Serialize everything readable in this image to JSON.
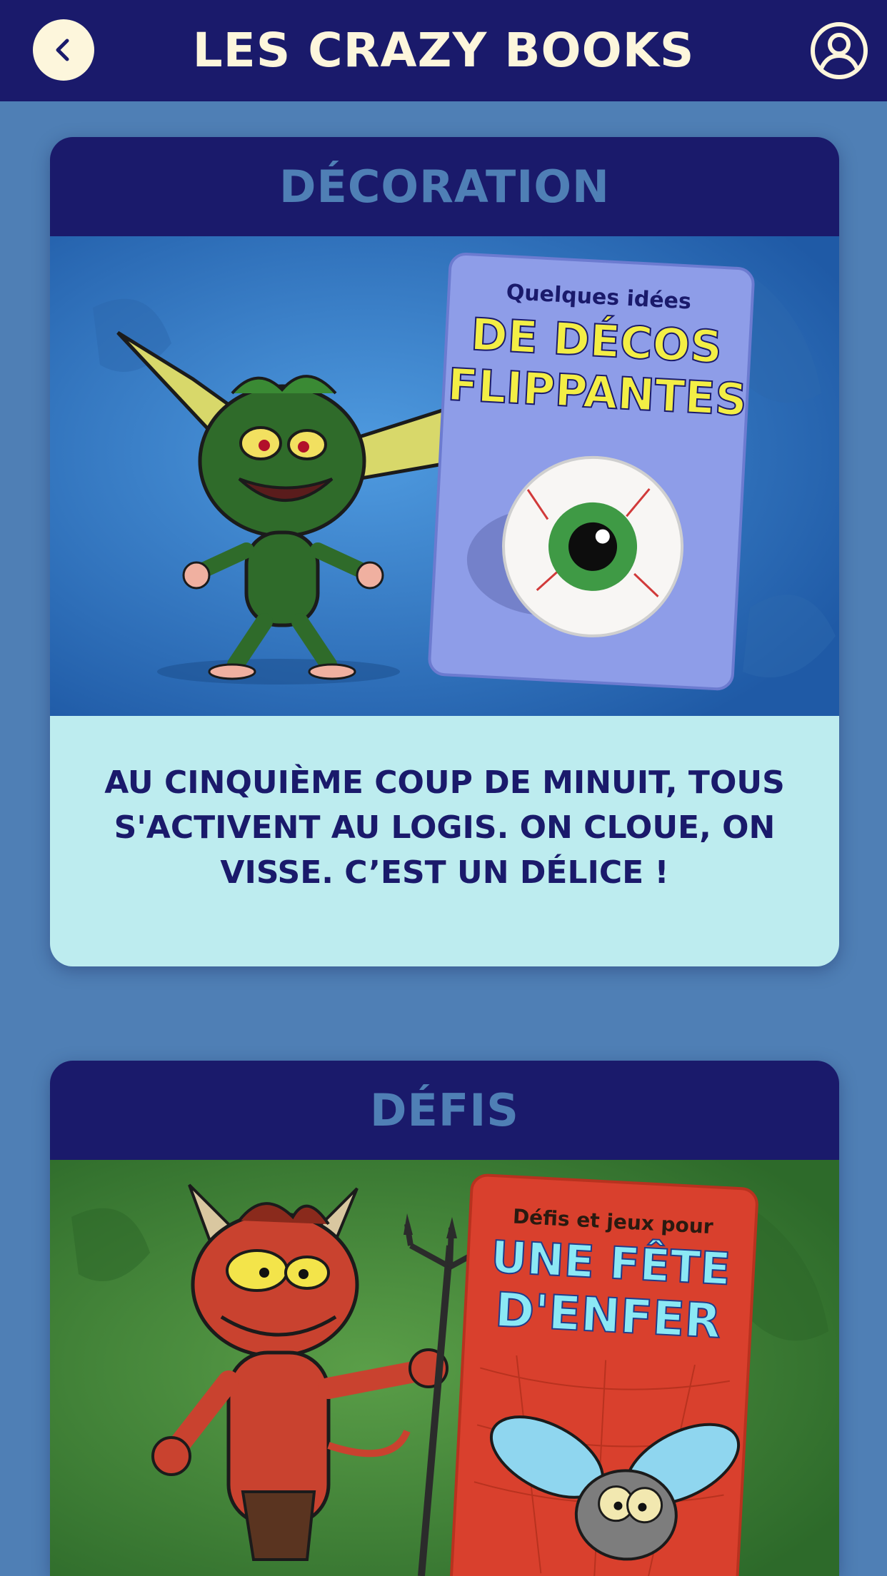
{
  "header": {
    "title": "LES CRAZY BOOKS",
    "back_icon": "chevron-left-icon",
    "profile_icon": "user-circle-icon"
  },
  "colors": {
    "navy": "#1a1a6b",
    "background_blue": "#4f7fb5",
    "cream": "#fdf6dc",
    "caption_bg": "#bdecef"
  },
  "categories": [
    {
      "title": "DÉCORATION",
      "book": {
        "kicker": "Quelques idées",
        "title_line1": "DE DÉCOS",
        "title_line2": "FLIPPANTES"
      },
      "caption": "AU CINQUIÈME COUP DE MINUIT, TOUS S'ACTIVENT AU LOGIS. ON CLOUE, ON VISSE. C’EST UN DÉLICE !"
    },
    {
      "title": "DÉFIS",
      "book": {
        "kicker": "Défis et jeux pour",
        "title_line1": "UNE FÊTE",
        "title_line2": "D'ENFER"
      }
    }
  ]
}
